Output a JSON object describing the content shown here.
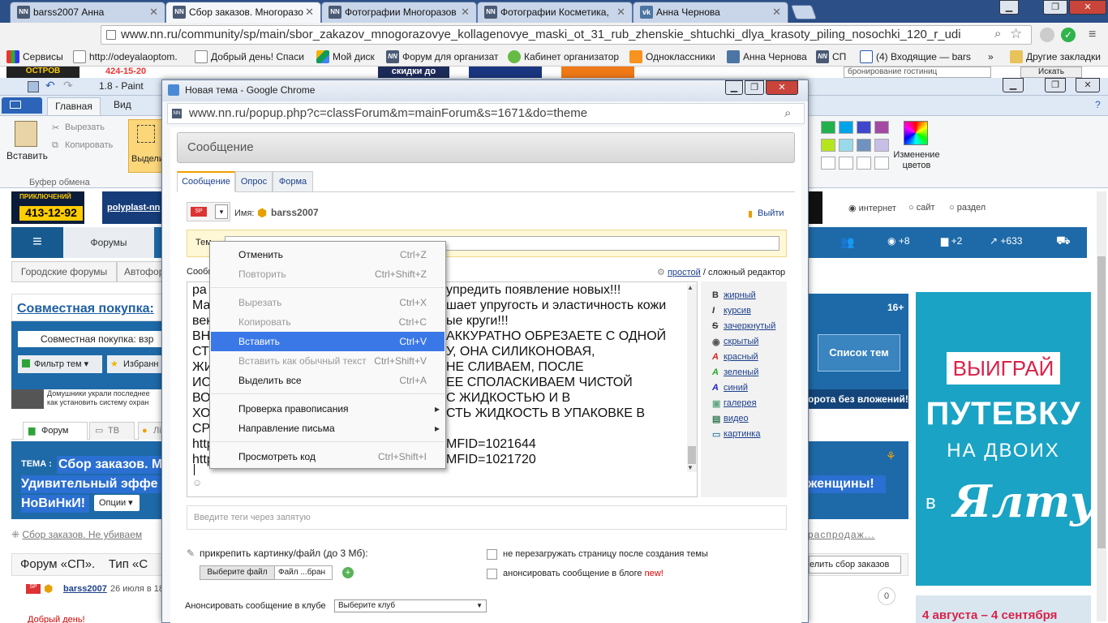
{
  "browser": {
    "tabs": [
      {
        "label": "barss2007 Анна",
        "active": false
      },
      {
        "label": "Сбор заказов. Многоразо",
        "active": true
      },
      {
        "label": "Фотографии Многоразов",
        "active": false
      },
      {
        "label": "Фотографии Косметика,",
        "active": false
      },
      {
        "label": "Анна Чернова",
        "active": false
      }
    ],
    "url": "www.nn.ru/community/sp/main/sbor_zakazov_mnogorazovye_kollagenovye_maski_ot_31_rub_zhenskie_shtuchki_dlya_krasoty_piling_nosochki_120_r_udi",
    "bookmarks": [
      "Сервисы",
      "http://odeyalaoptom.",
      "Добрый день! Спаси",
      "Мой диск",
      "Форум для организат",
      "Кабинет организатор",
      "Одноклассники",
      "Анна Чернова",
      "СП",
      "(4) Входящие — bars",
      "»",
      "Другие закладки"
    ]
  },
  "paint": {
    "title": "1.8 - Paint",
    "menu": {
      "file": "",
      "home": "Главная",
      "view": "Вид"
    },
    "paste": "Вставить",
    "cut": "Вырезать",
    "copy": "Копировать",
    "clipboard_group": "Буфер обмена",
    "select": "Выдели",
    "edit_colors": "Изменение цветов"
  },
  "bgpage": {
    "phone": "413-12-92",
    "adventure": "ПРИКЛЮЧЕНИЙ",
    "polyplast": "polyplast-nn",
    "phone_top": "424-15-20",
    "skidki": "скидки до",
    "forums": "Форумы",
    "city_forums": "Городские форумы",
    "autoforums": "Автофор",
    "joint_purchase": "Совместная покупка",
    "breadcrumb_input": "Совместная покупка: взр",
    "filter": "Фильтр тем",
    "favorites": "Избранн",
    "news1": "Домушники украли последнее",
    "news2": "как установить систему охран",
    "tab_forum": "Форум",
    "tab_tv": "ТВ",
    "tab_more": "Лі",
    "theme_label": "ТЕМА :",
    "theme_title": "Сбор заказов. М",
    "theme_line2": "Удивительный эффе",
    "theme_line3": "НоВиНкИ!",
    "options": "Опции",
    "women_tail": "женщины!",
    "prev_topic": "Сбор заказов. Не убиваем",
    "next_topic": "распродаж...",
    "forum_sp": "Форум «СП».",
    "topic_type": "Тип «С",
    "user": "barss2007",
    "post_date": "26 июля в 18",
    "greeting": "Добрый день!",
    "count_zero": "0",
    "stats_views": "+8",
    "stats_comments": "+2",
    "stats_rating": "+633",
    "search_radios": [
      "интернет",
      "сайт",
      "раздел"
    ],
    "search_text": "бронирование гостиниц",
    "search_btn": "Искать",
    "badge_16": "16+",
    "list_topics": "Список тем",
    "loans": "орота без вложений!",
    "finish_order": "елить сбор заказов"
  },
  "ad": {
    "line1": "ВЫИГРАЙ",
    "line2": "ПУТЕВКУ",
    "line3": "НА ДВОИХ",
    "line4_prefix": "в",
    "line4_city": "Ялту",
    "dates": "4 августа – 4 сентября"
  },
  "popup": {
    "title": "Новая тема - Google Chrome",
    "url": "www.nn.ru/popup.php?c=classForum&m=mainForum&s=1671&do=theme",
    "heading": "Сообщение",
    "tabs": [
      "Сообщение",
      "Опрос",
      "Форма"
    ],
    "name_label": "Имя:",
    "username": "barss2007",
    "logout": "Выйти",
    "subject_label": "Тем",
    "message_label": "Сообщ",
    "simple_editor": "простой",
    "complex_editor": "/ сложный редактор",
    "body_lines": [
      "ра",
      "Ма",
      "век",
      "ВН",
      "СТ",
      "ЖИ",
      "ИС",
      "ВО",
      "ХО",
      "СР",
      "http",
      "http"
    ],
    "body_tails": [
      "упредить появление новых!!!",
      "шает упругость и эластичность кожи",
      "ые круги!!!",
      "АККУРАТНО ОБРЕЗАЕТЕ С ОДНОЙ",
      "У, ОНА СИЛИКОНОВАЯ,",
      "НЕ СЛИВАЕМ, ПОСЛЕ",
      "ЕЕ СПОЛАСКИВАЕМ ЧИСТОЙ",
      "С ЖИДКОСТЬЮ И В",
      "СТЬ ЖИДКОСТЬ В УПАКОВКЕ В",
      "",
      "MFID=1021644",
      "MFID=1021720"
    ],
    "format": [
      "жирный",
      "курсив",
      "зачеркнутый",
      "скрытый",
      "красный",
      "зеленый",
      "синий",
      "галерея",
      "видео",
      "картинка"
    ],
    "tags_placeholder": "Введите теги через запятую",
    "attach_label": "прикрепить картинку/файл (до 3 Мб):",
    "choose_file": "Выберите файл",
    "file_status": "Файл ...бран",
    "no_reload": "не перезагружать страницу после создания темы",
    "announce_blog": "анонсировать сообщение в блоге",
    "new_badge": "new!",
    "announce_club": "Анонсировать сообщение в клубе",
    "club_select": "Выберите клуб"
  },
  "context_menu": {
    "items": [
      {
        "label": "Отменить",
        "shortcut": "Ctrl+Z",
        "disabled": false
      },
      {
        "label": "Повторить",
        "shortcut": "Ctrl+Shift+Z",
        "disabled": true
      },
      {
        "label": "Вырезать",
        "shortcut": "Ctrl+X",
        "disabled": true
      },
      {
        "label": "Копировать",
        "shortcut": "Ctrl+C",
        "disabled": true
      },
      {
        "label": "Вставить",
        "shortcut": "Ctrl+V",
        "disabled": false,
        "highlighted": true
      },
      {
        "label": "Вставить как обычный текст",
        "shortcut": "Ctrl+Shift+V",
        "disabled": true
      },
      {
        "label": "Выделить все",
        "shortcut": "Ctrl+A",
        "disabled": false
      },
      {
        "label": "Проверка правописания",
        "shortcut": "",
        "disabled": false,
        "submenu": true
      },
      {
        "label": "Направление письма",
        "shortcut": "",
        "disabled": false,
        "submenu": true
      },
      {
        "label": "Просмотреть код",
        "shortcut": "Ctrl+Shift+I",
        "disabled": false
      }
    ]
  },
  "colors": {
    "accent": "#3b78e7",
    "nn_blue": "#1e6aa8",
    "theme_highlight": "#2a6fd1",
    "ad_bg": "#1aa3c4",
    "ad_red": "#d8234a"
  }
}
